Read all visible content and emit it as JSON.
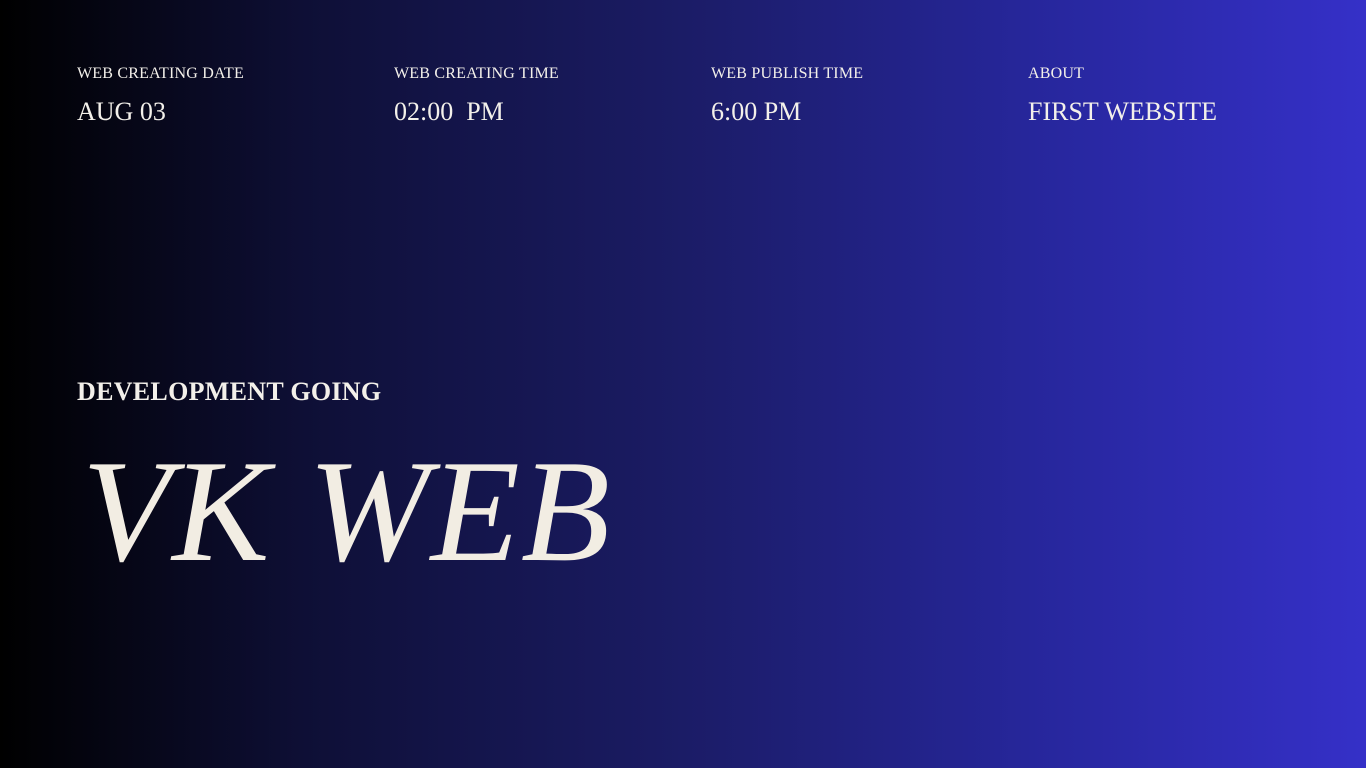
{
  "info": [
    {
      "label": "WEB CREATING DATE",
      "value": "AUG 03"
    },
    {
      "label": "WEB CREATING TIME",
      "value": "02:00  PM"
    },
    {
      "label": "WEB PUBLISH TIME",
      "value": "6:00 PM"
    },
    {
      "label": "ABOUT",
      "value": "FIRST WEBSITE"
    }
  ],
  "subtitle": "DEVELOPMENT GOING",
  "hero_title": "VK WEB",
  "colors": {
    "gradient_start": "#000000",
    "gradient_end": "#3530c8",
    "text": "#f3f0ea"
  }
}
